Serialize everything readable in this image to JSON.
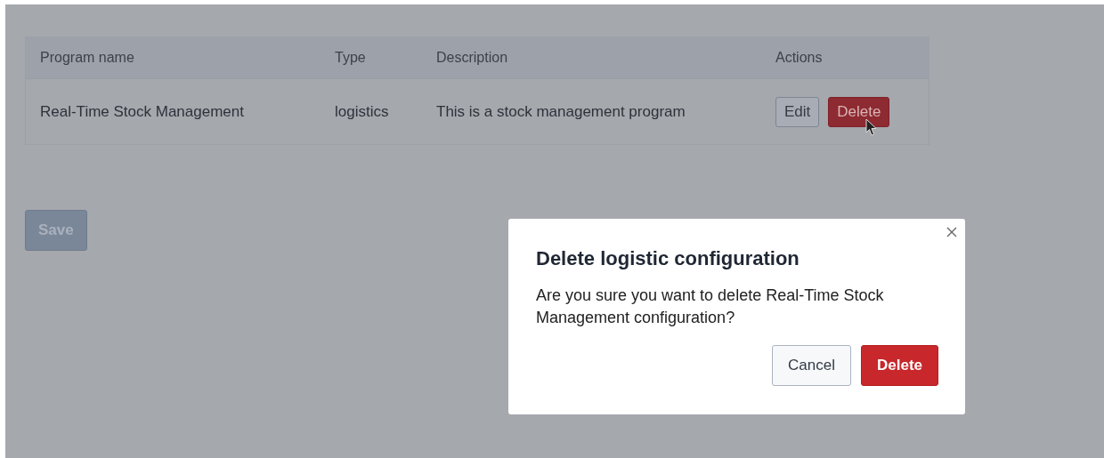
{
  "table": {
    "columns": [
      "Program name",
      "Type",
      "Description",
      "Actions"
    ],
    "rows": [
      {
        "name": "Real-Time Stock Management",
        "type": "logistics",
        "description": "This is a stock management program",
        "actions": [
          {
            "label": "Edit",
            "kind": "secondary"
          },
          {
            "label": "Delete",
            "kind": "danger"
          }
        ]
      }
    ]
  },
  "save_button": {
    "label": "Save",
    "disabled": true
  },
  "dialog": {
    "title": "Delete logistic configuration",
    "message": "Are you sure you want to delete Real-Time Stock Management configuration?",
    "buttons": [
      {
        "label": "Cancel",
        "kind": "secondary"
      },
      {
        "label": "Delete",
        "kind": "danger"
      }
    ]
  }
}
